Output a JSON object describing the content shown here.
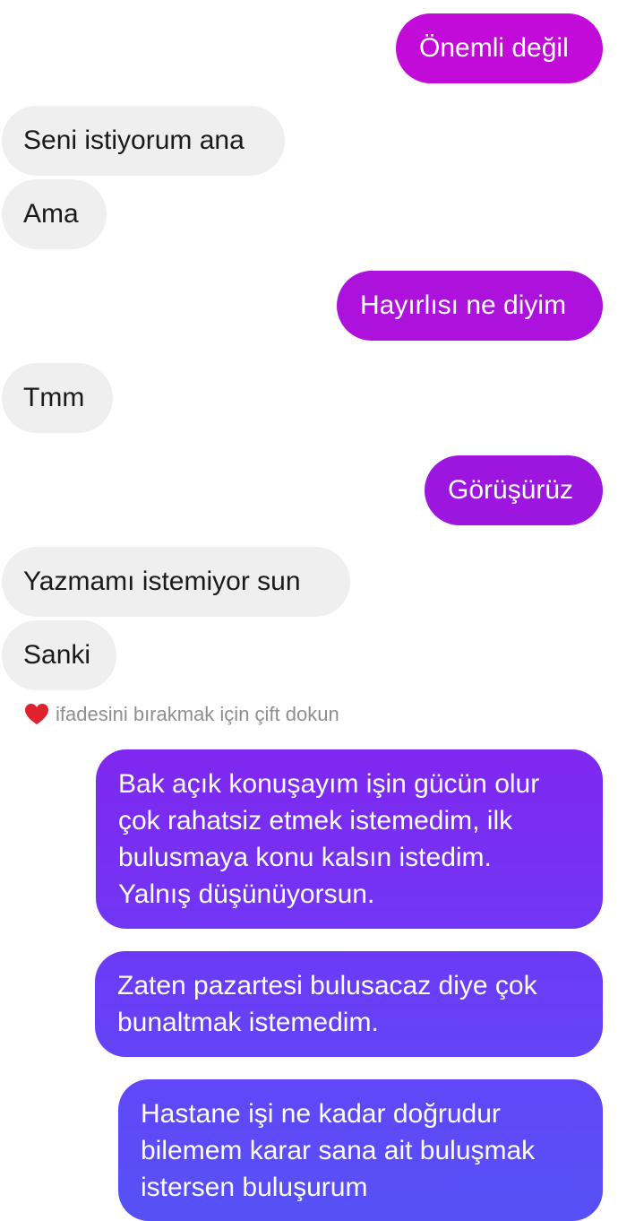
{
  "conversation": {
    "messages": [
      {
        "id": "m1",
        "direction": "outgoing",
        "text": "Önemli değil"
      },
      {
        "id": "m2",
        "direction": "incoming",
        "text": "Seni istiyorum ana"
      },
      {
        "id": "m3",
        "direction": "incoming",
        "text": "Ama"
      },
      {
        "id": "m4",
        "direction": "outgoing",
        "text": "Hayırlısı ne diyim"
      },
      {
        "id": "m5",
        "direction": "incoming",
        "text": "Tmm"
      },
      {
        "id": "m6",
        "direction": "outgoing",
        "text": "Görüşürüz"
      },
      {
        "id": "m7",
        "direction": "incoming",
        "text": "Yazmamı istemiyor sun"
      },
      {
        "id": "m8",
        "direction": "incoming",
        "text": "Sanki"
      },
      {
        "id": "m9",
        "direction": "outgoing",
        "text": "Bak açık konuşayım işin gücün olur\nçok rahatsiz etmek istemedim, ilk\nbulusmaya konu kalsın istedim.\nYalnış düşünüyorsun."
      },
      {
        "id": "m10",
        "direction": "outgoing",
        "text": "Zaten pazartesi bulusacaz diye çok\nbunaltmak istemedim."
      },
      {
        "id": "m11",
        "direction": "outgoing",
        "text": "Hastane işi ne kadar doğrudur\nbilemem karar sana ait buluşmak\nistersen buluşurum"
      }
    ],
    "reaction_hint": {
      "icon": "heart-icon",
      "text": "ifadesini bırakmak için çift dokun"
    }
  },
  "colors": {
    "incoming_bubble": "#efefef",
    "incoming_text": "#1a1a1a",
    "outgoing_text": "#ffffff",
    "outgoing_gradient": [
      "#c20bd8",
      "#a913dc",
      "#7d29f1",
      "#6a3bf6",
      "#5a4ef7"
    ],
    "heart": "#e0212e",
    "hint_text": "#8e8e8e"
  }
}
